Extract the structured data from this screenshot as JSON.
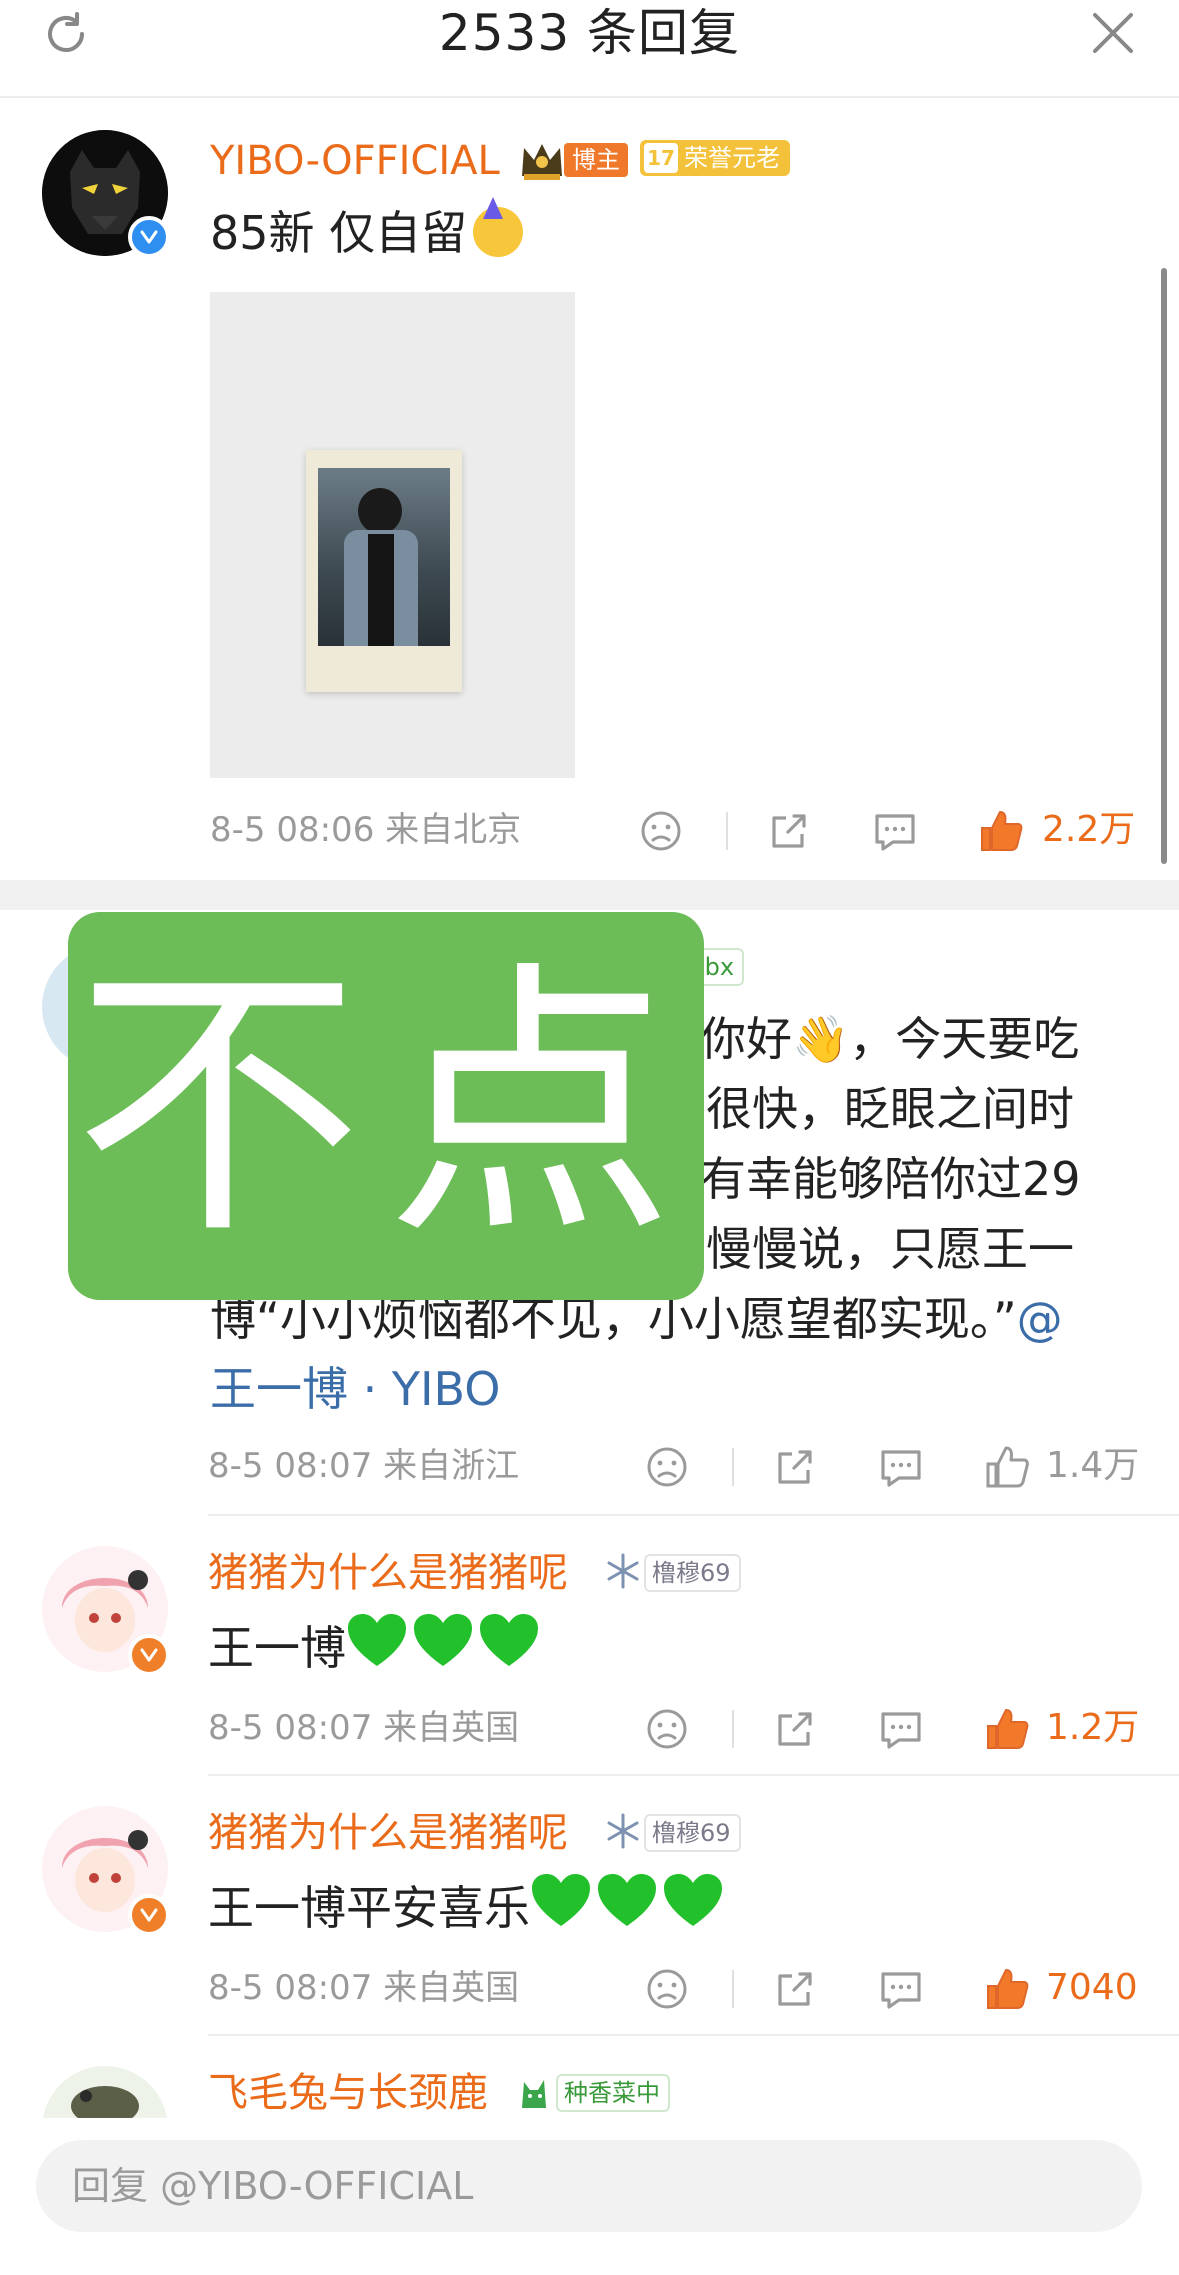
{
  "header": {
    "title": "2533 条回复"
  },
  "main_comment": {
    "username": "YIBO-OFFICIAL",
    "tag_host": "博主",
    "tag_honor_level": "17",
    "tag_honor": "荣誉元老",
    "text": "85新 仅自留",
    "meta": "8-5 08:06 来自北京",
    "likes": "2.2万"
  },
  "watermark": {
    "text": "不点"
  },
  "comment2": {
    "tag_partial": "ibx",
    "line1": "博你好👋，今天要吃",
    "line2": "得很快，眨眼之间时",
    "line3": "常有幸能够陪你过29",
    "line4": "里慢慢说，只愿王一",
    "line5": "博“小小烦恼都不见，小小愿望都实现。”",
    "mention_a": "@",
    "mention_b": "王一博 · YIBO",
    "meta": "8-5 08:07 来自浙江",
    "likes": "1.4万"
  },
  "comment3": {
    "username": "猪猪为什么是猪猪呢",
    "tag": "橹穆69",
    "text": "王一博",
    "meta": "8-5 08:07 来自英国",
    "likes": "1.2万"
  },
  "comment4": {
    "username": "猪猪为什么是猪猪呢",
    "tag": "橹穆69",
    "text": "王一博平安喜乐",
    "meta": "8-5 08:07 来自英国",
    "likes": "7040"
  },
  "comment5": {
    "username": "飞毛兔与长颈鹿",
    "tag": "种香菜中"
  },
  "reply_input": {
    "placeholder": "回复 @YIBO-OFFICIAL"
  },
  "colors": {
    "accent_orange": "#ea6b1a",
    "link_blue": "#3b6ea8",
    "watermark_green": "#6cbd58",
    "heart_green": "#22c12b"
  },
  "icons": [
    "refresh-icon",
    "close-icon",
    "verified-icon",
    "crown-icon",
    "dislike-icon",
    "share-icon",
    "comment-icon",
    "like-icon",
    "snowflake-icon",
    "cat-icon"
  ]
}
